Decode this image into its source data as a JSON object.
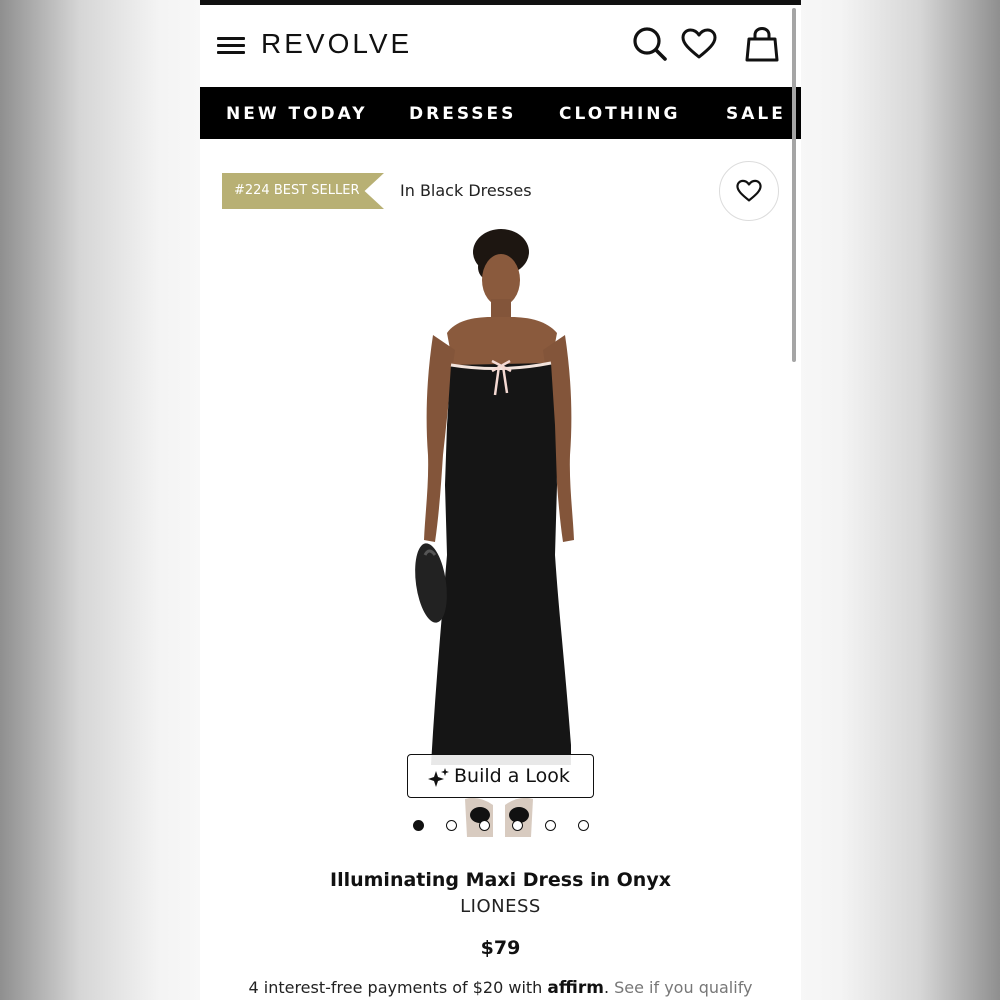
{
  "header": {
    "brand": "REVOLVE",
    "icons": [
      "menu-icon",
      "search-icon",
      "heart-icon",
      "shopping-bag-icon"
    ]
  },
  "nav": {
    "items": [
      {
        "label": "NEW TODAY"
      },
      {
        "label": "DRESSES"
      },
      {
        "label": "CLOTHING"
      },
      {
        "label": "SALE"
      }
    ]
  },
  "badge": {
    "rank_text": "#224 BEST SELLER",
    "category_text": "In Black Dresses",
    "color": "#b8b074"
  },
  "gallery": {
    "build_look_label": "Build a Look",
    "total_images": 6,
    "active_index": 0
  },
  "product": {
    "title": "Illuminating Maxi Dress in Onyx",
    "brand": "LIONESS",
    "price": "$79"
  },
  "payment": {
    "text": "4 interest-free payments of $20 with ",
    "provider": "affirm",
    "qualify_text": " See if you qualify"
  }
}
